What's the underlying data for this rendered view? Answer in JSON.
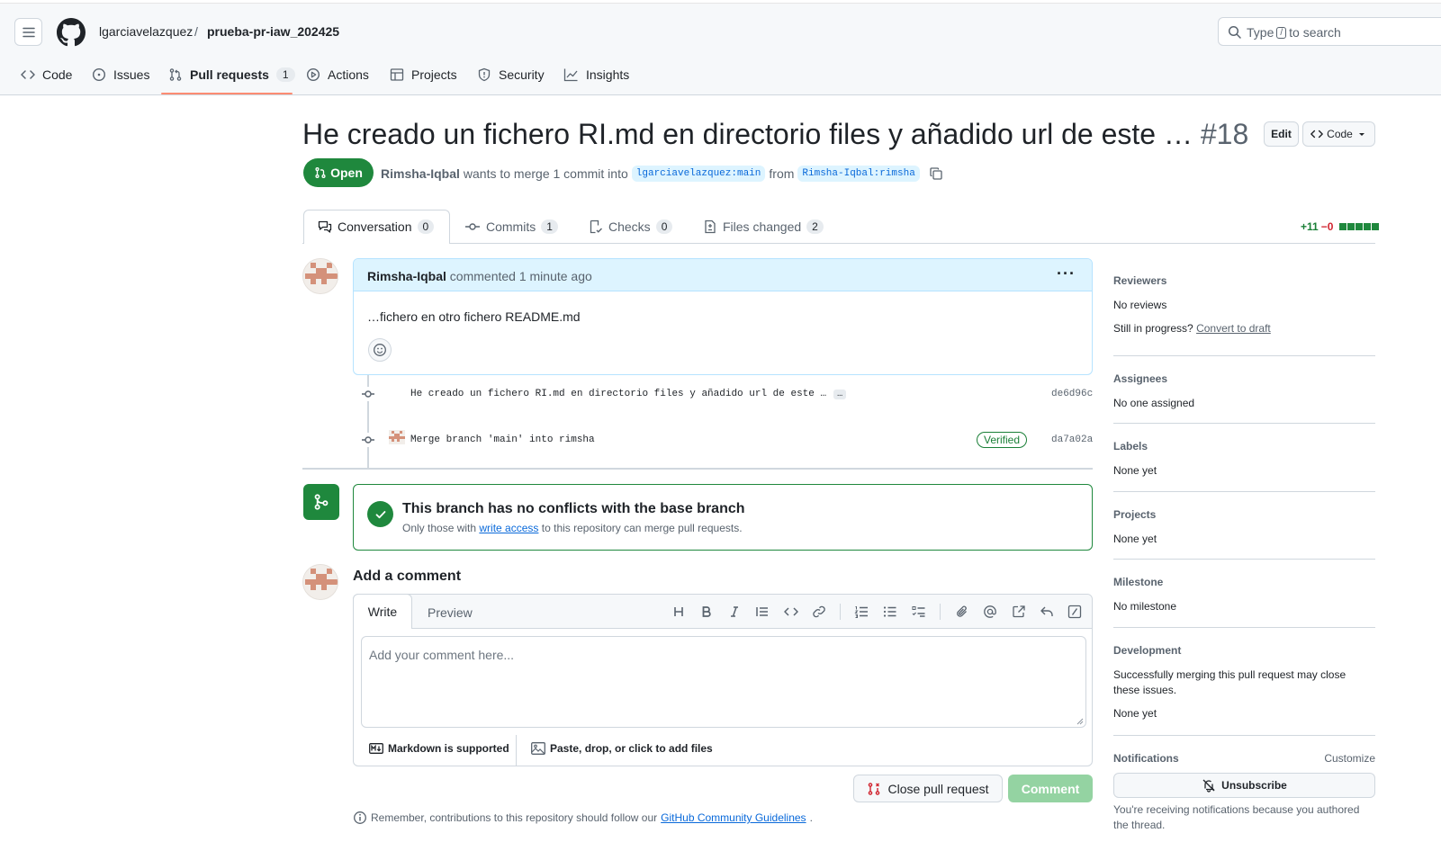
{
  "header": {
    "owner": "lgarciavelazquez",
    "separator": "/",
    "repo": "prueba-pr-iaw_202425",
    "search_prefix": "Type",
    "search_key": "/",
    "search_suffix": "to search"
  },
  "repo_nav": {
    "tabs": [
      {
        "label": "Code",
        "icon": "code-icon"
      },
      {
        "label": "Issues",
        "icon": "issue-icon"
      },
      {
        "label": "Pull requests",
        "icon": "pull-request-icon",
        "count": "1",
        "active": true
      },
      {
        "label": "Actions",
        "icon": "play-icon"
      },
      {
        "label": "Projects",
        "icon": "table-icon"
      },
      {
        "label": "Security",
        "icon": "shield-icon"
      },
      {
        "label": "Insights",
        "icon": "graph-icon"
      }
    ]
  },
  "pr": {
    "title": "He creado un fichero RI.md en directorio files y añadido url de este …",
    "number": "#18",
    "edit_label": "Edit",
    "code_label": "Code",
    "state": "Open",
    "author": "Rimsha-Iqbal",
    "merge_text": "wants to merge 1 commit into",
    "base_branch": "lgarciavelazquez:main",
    "from_text": "from",
    "head_branch": "Rimsha-Iqbal:rimsha"
  },
  "pr_tabs": [
    {
      "label": "Conversation",
      "count": "0",
      "icon": "comment-discussion-icon"
    },
    {
      "label": "Commits",
      "count": "1",
      "icon": "commit-icon"
    },
    {
      "label": "Checks",
      "count": "0",
      "icon": "checklist-icon"
    },
    {
      "label": "Files changed",
      "count": "2",
      "icon": "file-diff-icon"
    }
  ],
  "diffstat": {
    "additions": "+11",
    "deletions": "−0"
  },
  "comment": {
    "author": "Rimsha-Iqbal",
    "action": "commented",
    "time": "1 minute ago",
    "body": "…fichero en otro fichero README.md"
  },
  "commits": [
    {
      "message": "He creado un fichero RI.md en directorio files y añadido url de este …",
      "more": "…",
      "sha": "de6d96c"
    },
    {
      "message": "Merge branch 'main' into rimsha",
      "badge": "Verified",
      "sha": "da7a02a"
    }
  ],
  "merge_status": {
    "title": "This branch has no conflicts with the base branch",
    "sub_prefix": "Only those with",
    "sub_link": "write access",
    "sub_suffix": "to this repository can merge pull requests."
  },
  "add_comment": {
    "title": "Add a comment",
    "tab_write": "Write",
    "tab_preview": "Preview",
    "placeholder": "Add your comment here...",
    "markdown_label": "Markdown is supported",
    "attach_label": "Paste, drop, or click to add files",
    "close_label": "Close pull request",
    "comment_label": "Comment",
    "remember_prefix": "Remember, contributions to this repository should follow our",
    "remember_link": "GitHub Community Guidelines",
    "remember_suffix": "."
  },
  "sidebar": {
    "reviewers": {
      "title": "Reviewers",
      "value": "No reviews",
      "progress_prefix": "Still in progress?",
      "progress_link": "Convert to draft"
    },
    "assignees": {
      "title": "Assignees",
      "value": "No one assigned"
    },
    "labels": {
      "title": "Labels",
      "value": "None yet"
    },
    "projects": {
      "title": "Projects",
      "value": "None yet"
    },
    "milestone": {
      "title": "Milestone",
      "value": "No milestone"
    },
    "development": {
      "title": "Development",
      "desc": "Successfully merging this pull request may close these issues.",
      "value": "None yet"
    },
    "notifications": {
      "title": "Notifications",
      "customize": "Customize",
      "unsubscribe": "Unsubscribe",
      "desc": "You're receiving notifications because you authored the thread."
    }
  },
  "colors": {
    "accent_green": "#1f883d",
    "link_blue": "#0969da",
    "nav_underline": "#fd8c73"
  }
}
